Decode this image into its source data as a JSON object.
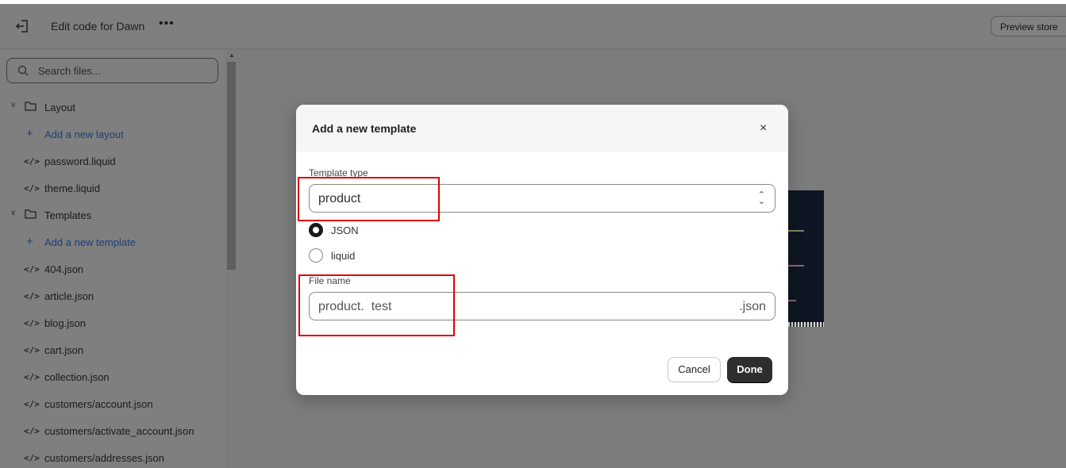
{
  "header": {
    "title": "Edit code for Dawn",
    "more_label": "•••",
    "preview_label": "Preview store"
  },
  "sidebar": {
    "search_placeholder": "Search files...",
    "items": [
      {
        "kind": "folder",
        "label": "Layout"
      },
      {
        "kind": "add",
        "label": "Add a new layout"
      },
      {
        "kind": "file",
        "label": "password.liquid"
      },
      {
        "kind": "file",
        "label": "theme.liquid"
      },
      {
        "kind": "folder",
        "label": "Templates"
      },
      {
        "kind": "add",
        "label": "Add a new template"
      },
      {
        "kind": "file",
        "label": "404.json"
      },
      {
        "kind": "file",
        "label": "article.json"
      },
      {
        "kind": "file",
        "label": "blog.json"
      },
      {
        "kind": "file",
        "label": "cart.json"
      },
      {
        "kind": "file",
        "label": "collection.json"
      },
      {
        "kind": "file",
        "label": "customers/account.json"
      },
      {
        "kind": "file",
        "label": "customers/activate_account.json"
      },
      {
        "kind": "file",
        "label": "customers/addresses.json"
      }
    ]
  },
  "modal": {
    "title": "Add a new template",
    "close_label": "×",
    "template_type_label": "Template type",
    "template_type_value": "product",
    "radio_json_label": "JSON",
    "radio_liquid_label": "liquid",
    "selected_format": "JSON",
    "file_name_label": "File name",
    "file_name_value": "product.  test",
    "file_name_suffix": ".json",
    "cancel_label": "Cancel",
    "done_label": "Done"
  },
  "colors": {
    "highlight": "#e00000",
    "link": "#1c3f78",
    "primary_button": "#2e2e2e"
  }
}
